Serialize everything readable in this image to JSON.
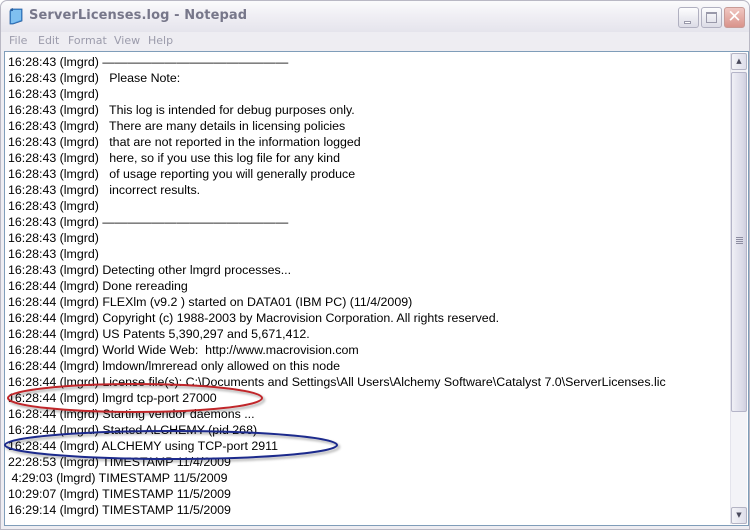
{
  "window": {
    "title": "ServerLicenses.log - Notepad",
    "icon": "notepad-icon",
    "controls": {
      "minimize": "minimize-icon",
      "maximize": "maximize-icon",
      "close": "close-icon"
    }
  },
  "menubar": {
    "items": [
      "File",
      "Edit",
      "Format",
      "View",
      "Help"
    ]
  },
  "document": {
    "lines": [
      "16:28:43 (lmgrd) ———————————————",
      "16:28:43 (lmgrd)   Please Note:",
      "16:28:43 (lmgrd)",
      "16:28:43 (lmgrd)   This log is intended for debug purposes only.",
      "16:28:43 (lmgrd)   There are many details in licensing policies",
      "16:28:43 (lmgrd)   that are not reported in the information logged",
      "16:28:43 (lmgrd)   here, so if you use this log file for any kind",
      "16:28:43 (lmgrd)   of usage reporting you will generally produce",
      "16:28:43 (lmgrd)   incorrect results.",
      "16:28:43 (lmgrd)",
      "16:28:43 (lmgrd) ———————————————",
      "16:28:43 (lmgrd)",
      "16:28:43 (lmgrd)",
      "16:28:43 (lmgrd) Detecting other lmgrd processes...",
      "16:28:44 (lmgrd) Done rereading",
      "16:28:44 (lmgrd) FLEXlm (v9.2 ) started on DATA01 (IBM PC) (11/4/2009)",
      "16:28:44 (lmgrd) Copyright (c) 1988-2003 by Macrovision Corporation. All rights reserved.",
      "16:28:44 (lmgrd) US Patents 5,390,297 and 5,671,412.",
      "16:28:44 (lmgrd) World Wide Web:  http://www.macrovision.com",
      "16:28:44 (lmgrd) lmdown/lmreread only allowed on this node",
      "16:28:44 (lmgrd) License file(s): C:\\Documents and Settings\\All Users\\Alchemy Software\\Catalyst 7.0\\ServerLicenses.lic",
      "16:28:44 (lmgrd) lmgrd tcp-port 27000",
      "16:28:44 (lmgrd) Starting vendor daemons ...",
      "16:28:44 (lmgrd) Started ALCHEMY (pid 268)",
      "16:28:44 (lmgrd) ALCHEMY using TCP-port 2911",
      "22:28:53 (lmgrd) TIMESTAMP 11/4/2009",
      " 4:29:03 (lmgrd) TIMESTAMP 11/5/2009",
      "10:29:07 (lmgrd) TIMESTAMP 11/5/2009",
      "16:29:14 (lmgrd) TIMESTAMP 11/5/2009"
    ]
  },
  "annotations": [
    {
      "label": "red-ellipse-highlight",
      "target_line": 21,
      "color": "#c0282a"
    },
    {
      "label": "blue-ellipse-highlight",
      "target_line": 24,
      "color": "#1c2a8c"
    }
  ],
  "scrollbar": {
    "up_arrow": "▲",
    "down_arrow": "▼",
    "position_fraction": 0.0,
    "visible_fraction": 0.88
  }
}
